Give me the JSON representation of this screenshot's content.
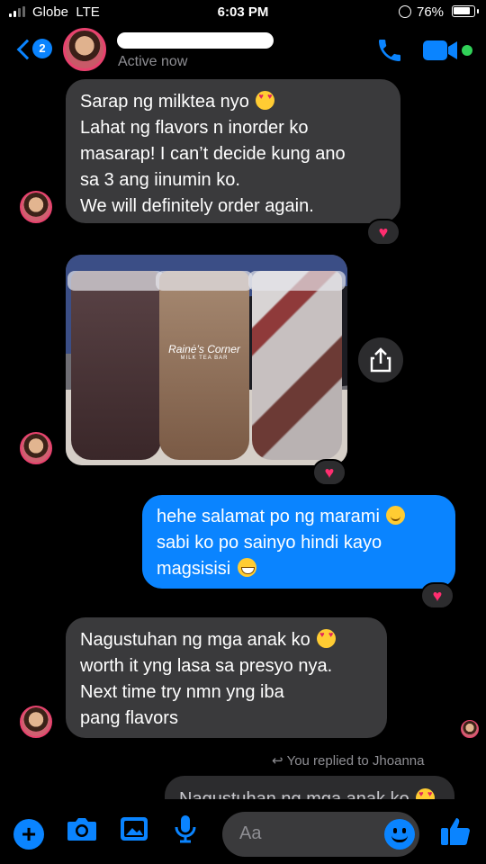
{
  "status_bar": {
    "carrier": "Globe",
    "network": "LTE",
    "time": "6:03 PM",
    "battery": "76%"
  },
  "header": {
    "back_badge": "2",
    "contact_status": "Active now"
  },
  "messages": [
    {
      "side": "in",
      "lines": [
        "Sarap ng milktea nyo",
        "Lahat ng flavors n inorder ko",
        "masarap! I can’t decide  kung ano",
        "sa 3 ang iinumin ko.",
        "We will definitely order again."
      ],
      "emoji": "heart-eyes-emoji",
      "reaction": "♥"
    },
    {
      "side": "in",
      "type": "photo",
      "cup_logo": "Rainė’s Corner",
      "cup_sub": "MILK TEA BAR",
      "reaction": "♥"
    },
    {
      "side": "out",
      "lines": [
        "hehe salamat po ng marami",
        "sabi ko po sainyo hindi kayo",
        "magsisisi"
      ],
      "emojis": [
        "smiling-face-emoji",
        "grinning-face-emoji"
      ],
      "reaction": "♥"
    },
    {
      "side": "in",
      "lines": [
        "Nagustuhan ng mga anak ko",
        "worth it yng lasa sa presyo nya.",
        "Next time try nmn yng iba",
        "pang flavors"
      ],
      "emoji": "heart-eyes-emoji"
    }
  ],
  "reply": {
    "label": "You replied to Jhoanna",
    "quote": "Nagustuhan ng mga anak ko"
  },
  "composer": {
    "placeholder": "Aa"
  },
  "colors": {
    "accent": "#0a84ff",
    "incoming_bubble": "#3a3a3c",
    "reaction": "#ff2d6f",
    "online": "#31d158"
  },
  "icons": [
    "back-chevron-icon",
    "phone-icon",
    "video-camera-icon",
    "share-icon",
    "plus-icon",
    "camera-icon",
    "image-icon",
    "microphone-icon",
    "emoji-icon",
    "thumbs-up-icon"
  ]
}
